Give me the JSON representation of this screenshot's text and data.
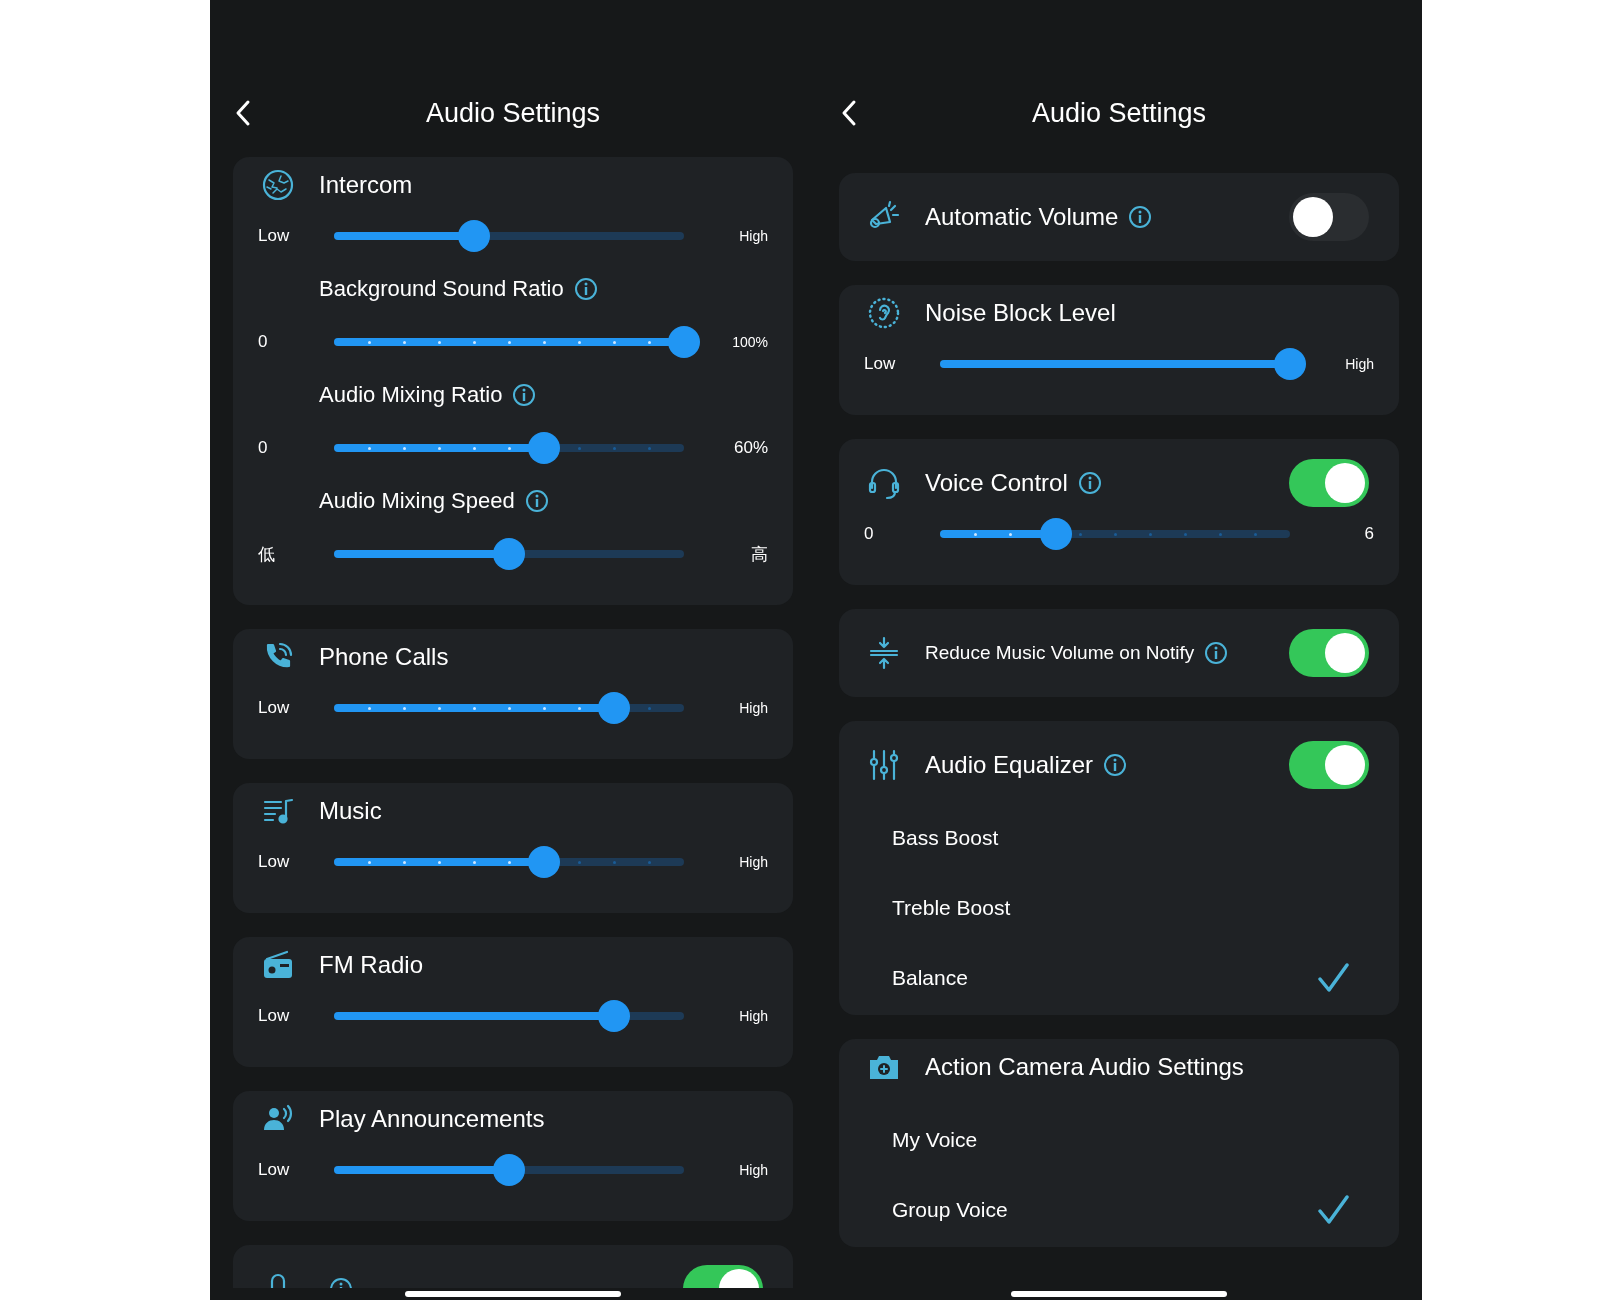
{
  "screens": [
    {
      "title": "Audio Settings",
      "cards": [
        {
          "kind": "standard",
          "title": "Intercom",
          "sliders": [
            {
              "kind": "plain",
              "min": "Low",
              "max": "High",
              "level": 0.4
            },
            {
              "kind": "dotted",
              "label": "Background Sound Ratio",
              "info": true,
              "min": "0",
              "max": "100%",
              "level": 1.0
            },
            {
              "kind": "dotted",
              "label": "Audio Mixing Ratio",
              "info": true,
              "min": "0",
              "max": "60%",
              "level": 0.6
            },
            {
              "kind": "plain",
              "label": "Audio Mixing Speed",
              "info": true,
              "min": "低",
              "max": "高",
              "level": 0.5
            }
          ]
        },
        {
          "kind": "standard",
          "title": "Phone Calls",
          "sliders": [
            {
              "kind": "dotted",
              "min": "Low",
              "max": "High",
              "level": 0.8
            }
          ]
        },
        {
          "kind": "standard",
          "title": "Music",
          "sliders": [
            {
              "kind": "dotted",
              "min": "Low",
              "max": "High",
              "level": 0.6
            }
          ]
        },
        {
          "kind": "standard",
          "title": "FM Radio",
          "sliders": [
            {
              "kind": "plain",
              "min": "Low",
              "max": "High",
              "level": 0.8
            }
          ]
        },
        {
          "kind": "standard",
          "title": "Play Announcements",
          "sliders": [
            {
              "kind": "plain",
              "min": "Low",
              "max": "High",
              "level": 0.5
            }
          ]
        },
        {
          "kind": "cut",
          "info": true,
          "toggle": {
            "on": true
          }
        }
      ]
    },
    {
      "title": "Audio Settings",
      "cards": [
        {
          "kind": "standard",
          "title": "Automatic Volume",
          "info": true,
          "toggle": {
            "on": false
          }
        },
        {
          "kind": "standard",
          "title": "Noise Block Level",
          "sliders": [
            {
              "kind": "plain",
              "min": "Low",
              "max": "High",
              "level": 1.0
            }
          ]
        },
        {
          "kind": "standard",
          "title": "Voice Control",
          "info": true,
          "toggle": {
            "on": true
          },
          "sliders": [
            {
              "kind": "dotted",
              "min": "0",
              "max": "6",
              "level": 0.33
            }
          ]
        },
        {
          "kind": "compact",
          "title": "Reduce Music Volume on Notify",
          "info": true,
          "toggle": {
            "on": true
          }
        },
        {
          "kind": "standard",
          "title": "Audio Equalizer",
          "info": true,
          "toggle": {
            "on": true
          },
          "options": [
            {
              "label": "Bass Boost",
              "selected": false
            },
            {
              "label": "Treble Boost",
              "selected": false
            },
            {
              "label": "Balance",
              "selected": true
            }
          ]
        },
        {
          "kind": "standard",
          "title": "Action Camera Audio Settings",
          "options": [
            {
              "label": "My Voice",
              "selected": false
            },
            {
              "label": "Group Voice",
              "selected": true
            }
          ]
        }
      ]
    }
  ]
}
